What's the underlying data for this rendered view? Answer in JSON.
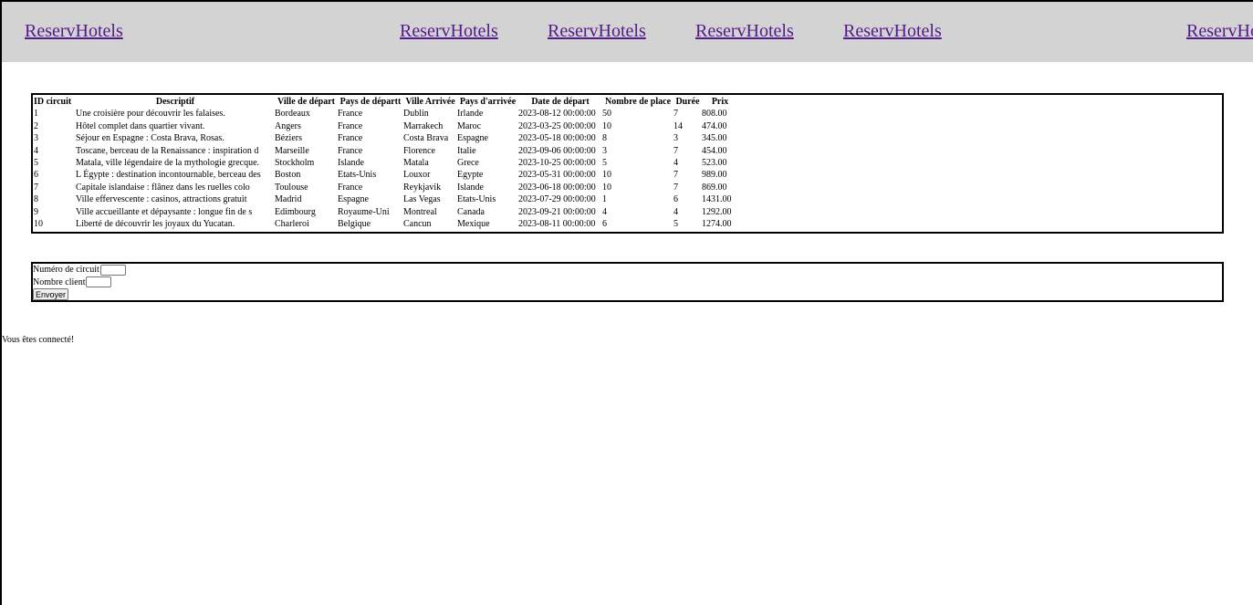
{
  "nav": {
    "links": [
      "ReservHotels",
      "ReservHotels",
      "ReservHotels",
      "ReservHotels",
      "ReservHotels",
      "ReservHotels"
    ]
  },
  "table": {
    "headers": [
      "ID circuit",
      "Descriptif",
      "Ville de départ",
      "Pays de départt",
      "Ville Arrivée",
      "Pays d'arrivée",
      "Date de départ",
      "Nombre de place",
      "Durée",
      "Prix"
    ],
    "rows": [
      [
        "1",
        "Une croisière pour découvrir les falaises.",
        "Bordeaux",
        "France",
        "Dublin",
        "Irlande",
        "2023-08-12 00:00:00",
        "50",
        "7",
        "808.00"
      ],
      [
        "2",
        "Hôtel complet dans quartier vivant.",
        "Angers",
        "France",
        "Marrakech",
        "Maroc",
        "2023-03-25 00:00:00",
        "10",
        "14",
        "474.00"
      ],
      [
        "3",
        "Séjour en Espagne : Costa Brava, Rosas.",
        "Béziers",
        "France",
        "Costa Brava",
        "Espagne",
        "2023-05-18 00:00:00",
        "8",
        "3",
        "345.00"
      ],
      [
        "4",
        "Toscane, berceau de la Renaissance : inspiration d",
        "Marseille",
        "France",
        "Florence",
        "Italie",
        "2023-09-06 00:00:00",
        "3",
        "7",
        "454.00"
      ],
      [
        "5",
        "Matala, ville légendaire de la mythologie grecque.",
        "Stockholm",
        "Islande",
        "Matala",
        "Grece",
        "2023-10-25 00:00:00",
        "5",
        "4",
        "523.00"
      ],
      [
        "6",
        "L Égypte : destination incontournable, berceau des",
        "Boston",
        "Etats-Unis",
        "Louxor",
        "Egypte",
        "2023-05-31 00:00:00",
        "10",
        "7",
        "989.00"
      ],
      [
        "7",
        "Capitale islandaise : flânez dans les ruelles colo",
        "Toulouse",
        "France",
        "Reykjavik",
        "Islande",
        "2023-06-18 00:00:00",
        "10",
        "7",
        "869.00"
      ],
      [
        "8",
        "Ville effervescente : casinos, attractions gratuit",
        "Madrid",
        "Espagne",
        "Las Vegas",
        "Etats-Unis",
        "2023-07-29 00:00:00",
        "1",
        "6",
        "1431.00"
      ],
      [
        "9",
        "Ville accueillante et dépaysante : longue fin de s",
        "Edimbourg",
        "Royaume-Uni",
        "Montreal",
        "Canada",
        "2023-09-21 00:00:00",
        "4",
        "4",
        "1292.00"
      ],
      [
        "10",
        "Liberté de découvrir les joyaux du Yucatan.",
        "Charleroi",
        "Belgique",
        "Cancun",
        "Mexique",
        "2023-08-11 00:00:00",
        "6",
        "5",
        "1274.00"
      ]
    ]
  },
  "form": {
    "circuit_label": "Numéro de circuit",
    "circuit_value": "",
    "client_label": "Nombre client",
    "client_value": "",
    "submit_label": "Envoyer"
  },
  "status": {
    "message": "Vous êtes connecté!"
  }
}
